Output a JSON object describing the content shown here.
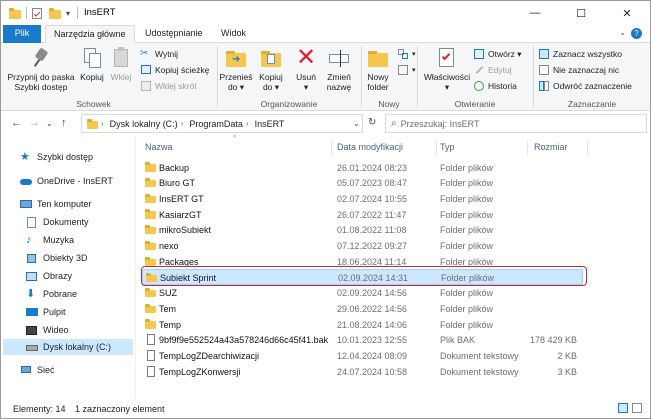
{
  "window": {
    "title": "InsERT",
    "minimize_glyph": "—",
    "maximize_glyph": "☐",
    "close_glyph": "✕"
  },
  "ribbon_tabs": {
    "file": "Plik",
    "home": "Narzędzia główne",
    "share": "Udostępnianie",
    "view": "Widok"
  },
  "ribbon": {
    "clipboard": {
      "label": "Schowek",
      "pin": "Przypnij do paska\nSzybki dostęp",
      "pin_line1": "Przypnij do paska",
      "pin_line2": "Szybki dostęp",
      "copy": "Kopiuj",
      "paste": "Wklej",
      "cut": "Wytnij",
      "copy_path": "Kopiuj ścieżkę",
      "paste_shortcut": "Wklej skrót"
    },
    "organize": {
      "label": "Organizowanie",
      "move_line1": "Przenieś",
      "move_line2": "do ▾",
      "copy_line1": "Kopiuj",
      "copy_line2": "do ▾",
      "delete_line1": "Usuń",
      "delete_line2": "▾",
      "rename_line1": "Zmień",
      "rename_line2": "nazwę"
    },
    "new": {
      "label": "Nowy",
      "folder_line1": "Nowy",
      "folder_line2": "folder"
    },
    "open": {
      "label": "Otwieranie",
      "properties_line1": "Właściwości",
      "properties_line2": "▾",
      "open": "Otwórz ▾",
      "edit": "Edytuj",
      "history": "Historia"
    },
    "select": {
      "label": "Zaznaczanie",
      "select_all": "Zaznacz wszystko",
      "select_none": "Nie zaznaczaj nic",
      "invert": "Odwróć zaznaczenie"
    }
  },
  "address": {
    "segments": [
      "Dysk lokalny (C:)",
      "ProgramData",
      "InsERT"
    ],
    "search_placeholder": "Przeszukaj: InsERT"
  },
  "sidebar": {
    "items": [
      {
        "label": "Szybki dostęp",
        "icon": "star-icon"
      },
      {
        "label": "OneDrive - InsERT",
        "icon": "cloud-icon"
      },
      {
        "label": "Ten komputer",
        "icon": "computer-icon"
      },
      {
        "label": "Dokumenty",
        "icon": "documents-icon"
      },
      {
        "label": "Muzyka",
        "icon": "music-icon"
      },
      {
        "label": "Obiekty 3D",
        "icon": "cube-icon"
      },
      {
        "label": "Obrazy",
        "icon": "pictures-icon"
      },
      {
        "label": "Pobrane",
        "icon": "download-icon"
      },
      {
        "label": "Pulpit",
        "icon": "desktop-icon"
      },
      {
        "label": "Wideo",
        "icon": "video-icon"
      },
      {
        "label": "Dysk lokalny (C:)",
        "icon": "drive-icon"
      },
      {
        "label": "Sieć",
        "icon": "network-icon"
      }
    ]
  },
  "columns": {
    "name": "Nazwa",
    "date": "Data modyfikacji",
    "type": "Typ",
    "size": "Rozmiar"
  },
  "files": [
    {
      "name": "Backup",
      "date": "26.01.2024 08:23",
      "type": "Folder plików",
      "size": "",
      "kind": "folder"
    },
    {
      "name": "Biuro GT",
      "date": "05.07.2023 08:47",
      "type": "Folder plików",
      "size": "",
      "kind": "folder"
    },
    {
      "name": "InsERT GT",
      "date": "02.07.2024 10:55",
      "type": "Folder plików",
      "size": "",
      "kind": "folder"
    },
    {
      "name": "KasiarzGT",
      "date": "26.07.2022 11:47",
      "type": "Folder plików",
      "size": "",
      "kind": "folder"
    },
    {
      "name": "mikroSubiekt",
      "date": "01.08.2022 11:08",
      "type": "Folder plików",
      "size": "",
      "kind": "folder"
    },
    {
      "name": "nexo",
      "date": "07.12.2022 09:27",
      "type": "Folder plików",
      "size": "",
      "kind": "folder"
    },
    {
      "name": "Packages",
      "date": "18.06.2024 11:14",
      "type": "Folder plików",
      "size": "",
      "kind": "folder"
    },
    {
      "name": "Subiekt Sprint",
      "date": "02.09.2024 14:31",
      "type": "Folder plików",
      "size": "",
      "kind": "folder"
    },
    {
      "name": "SUZ",
      "date": "02.09.2024 14:56",
      "type": "Folder plików",
      "size": "",
      "kind": "folder"
    },
    {
      "name": "Tem",
      "date": "29.06.2022 14:56",
      "type": "Folder plików",
      "size": "",
      "kind": "folder"
    },
    {
      "name": "Temp",
      "date": "21.08.2024 14:06",
      "type": "Folder plików",
      "size": "",
      "kind": "folder"
    },
    {
      "name": "9bf9f9e552524a43a578246d66c45f41.bak",
      "date": "10.01.2023 12:55",
      "type": "Plik BAK",
      "size": "178 429 KB",
      "kind": "file"
    },
    {
      "name": "TempLogZDearchiwizacji",
      "date": "12.04.2024 08:09",
      "type": "Dokument tekstowy",
      "size": "2 KB",
      "kind": "file"
    },
    {
      "name": "TempLogZKonwersji",
      "date": "24.07.2024 10:58",
      "type": "Dokument tekstowy",
      "size": "3 KB",
      "kind": "file"
    }
  ],
  "status": {
    "count": "Elementy: 14",
    "selected": "1 zaznaczony element"
  },
  "colors": {
    "accent": "#1979ca",
    "folder": "#f5c74f",
    "selection": "#cce8ff",
    "highlight_border": "#d9232d"
  }
}
